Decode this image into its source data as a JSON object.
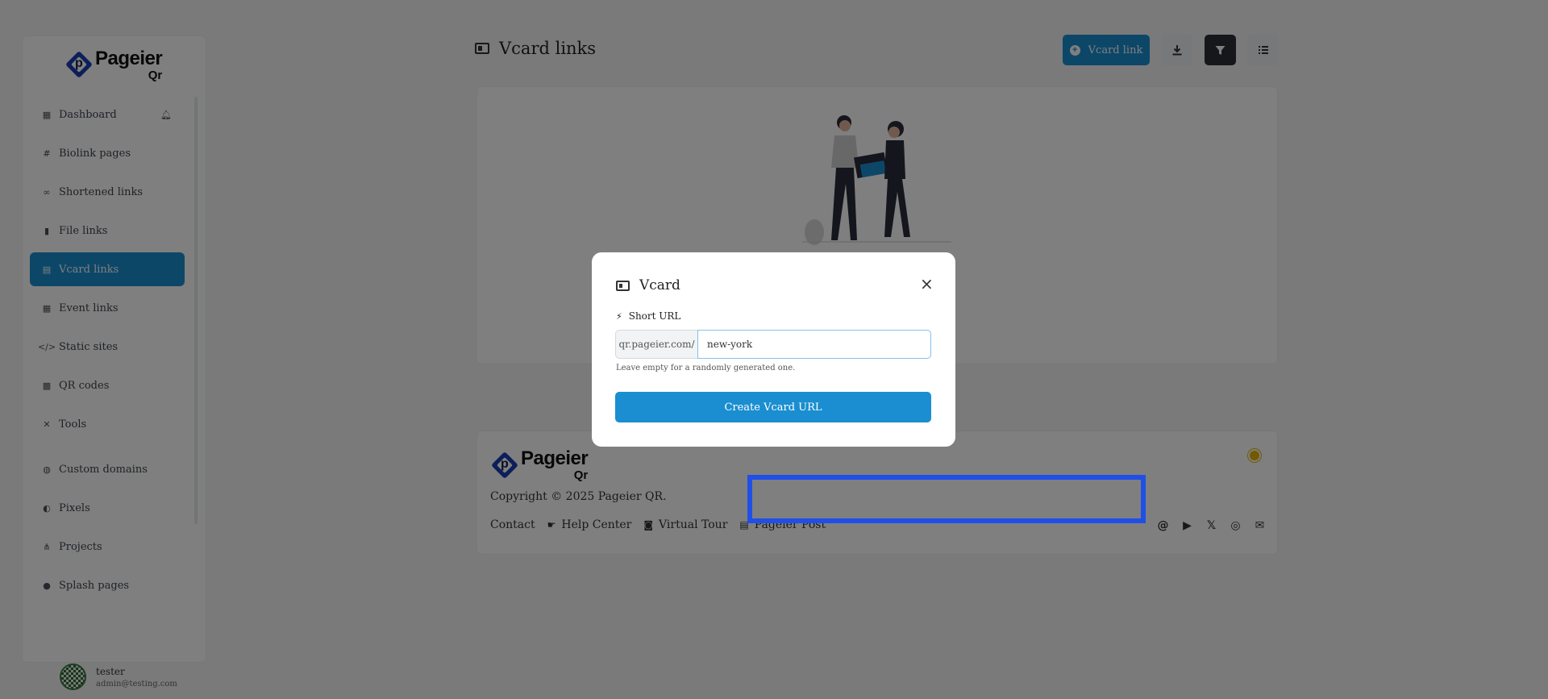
{
  "brand": {
    "name_line1": "Pageier",
    "name_line2": "Qr",
    "mark_letter": "p"
  },
  "sidebar": {
    "items": [
      {
        "label": "Dashboard",
        "icon": "table-icon"
      },
      {
        "label": "Biolink pages",
        "icon": "hashtag-icon"
      },
      {
        "label": "Shortened links",
        "icon": "link-icon"
      },
      {
        "label": "File links",
        "icon": "file-icon"
      },
      {
        "label": "Vcard links",
        "icon": "id-card-icon",
        "active": true
      },
      {
        "label": "Event links",
        "icon": "calendar-icon"
      },
      {
        "label": "Static sites",
        "icon": "code-icon"
      },
      {
        "label": "QR codes",
        "icon": "qrcode-icon"
      },
      {
        "label": "Tools",
        "icon": "tools-icon"
      },
      {
        "label": "Custom domains",
        "icon": "globe-icon"
      },
      {
        "label": "Pixels",
        "icon": "adjust-icon"
      },
      {
        "label": "Projects",
        "icon": "project-diagram-icon"
      },
      {
        "label": "Splash pages",
        "icon": "droplet-icon"
      }
    ],
    "user": {
      "name": "tester",
      "email": "admin@testing.com"
    }
  },
  "header": {
    "title": "Vcard links",
    "primary_button": "Vcard link"
  },
  "footer": {
    "copyright": "Copyright © 2025 Pageier QR.",
    "links": [
      "Contact",
      "Help Center",
      "Virtual Tour",
      "Pageier Post"
    ],
    "socials": [
      "threads-icon",
      "youtube-icon",
      "x-icon",
      "instagram-icon",
      "envelope-icon"
    ]
  },
  "modal": {
    "title": "Vcard",
    "field_label": "Short URL",
    "prefix": "qr.pageier.com/",
    "input_value": "new-york",
    "help": "Leave empty for a randomly generated one.",
    "submit": "Create Vcard URL"
  },
  "colors": {
    "accent": "#1a8ed0",
    "highlight": "#1f4fe6",
    "brand": "#1a3fb5"
  }
}
